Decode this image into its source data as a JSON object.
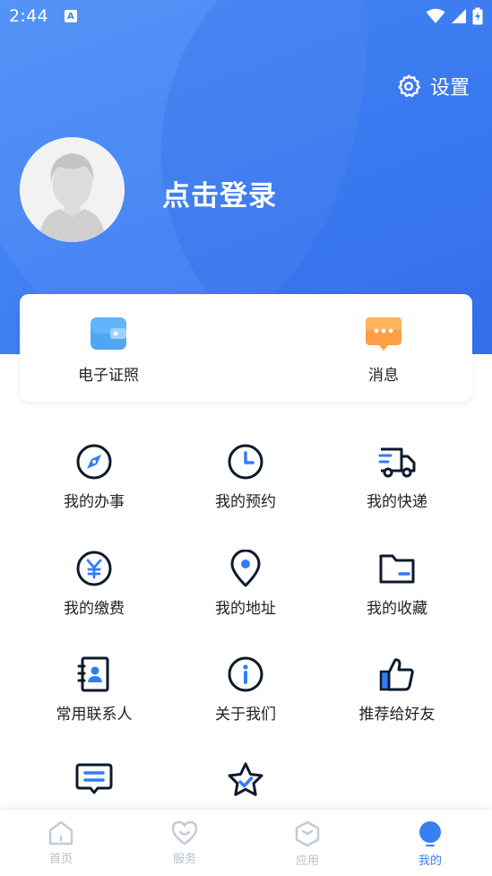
{
  "status_bar": {
    "time": "2:44",
    "indicator": "A"
  },
  "header": {
    "settings_label": "设置",
    "login_label": "点击登录"
  },
  "quick_card": [
    {
      "label": "电子证照",
      "icon": "wallet-icon",
      "color": "#3f9af2"
    },
    {
      "label": "消息",
      "icon": "message-icon",
      "color": "#ffa54c"
    }
  ],
  "menu": [
    {
      "label": "我的办事",
      "icon": "compass-icon"
    },
    {
      "label": "我的预约",
      "icon": "clock-icon"
    },
    {
      "label": "我的快递",
      "icon": "truck-icon"
    },
    {
      "label": "我的缴费",
      "icon": "yen-icon"
    },
    {
      "label": "我的地址",
      "icon": "location-pin-icon"
    },
    {
      "label": "我的收藏",
      "icon": "folder-icon"
    },
    {
      "label": "常用联系人",
      "icon": "contacts-icon"
    },
    {
      "label": "关于我们",
      "icon": "info-icon"
    },
    {
      "label": "推荐给好友",
      "icon": "thumbs-up-icon"
    },
    {
      "label": "",
      "icon": "feedback-icon"
    },
    {
      "label": "",
      "icon": "star-icon"
    }
  ],
  "tabbar": [
    {
      "label": "首页",
      "icon": "home-icon"
    },
    {
      "label": "服务",
      "icon": "heart-icon"
    },
    {
      "label": "应用",
      "icon": "box-icon"
    },
    {
      "label": "我的",
      "icon": "profile-icon",
      "active": true
    }
  ],
  "colors": {
    "primary": "#3f80f3",
    "accent": "#2f7ef5",
    "icon_stroke": "#0d1a2b"
  }
}
